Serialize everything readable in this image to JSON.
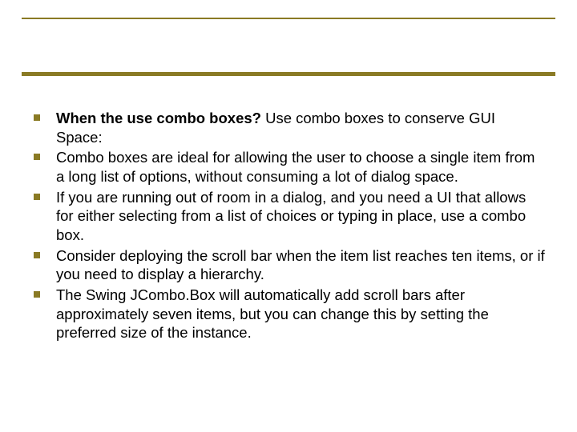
{
  "bullets": [
    {
      "bold_lead": "When the use combo boxes? ",
      "rest": "Use combo boxes to conserve GUI Space:"
    },
    {
      "bold_lead": "",
      "rest": "Combo boxes are ideal for allowing the user to choose a single item from a long list of options, without consuming a lot of dialog space."
    },
    {
      "bold_lead": "",
      "rest": "If you are running out of room in a dialog, and you need a UI that allows for either selecting from a list of choices or typing in place, use a combo box."
    },
    {
      "bold_lead": "",
      "rest": "Consider deploying the scroll bar when the item list reaches ten items, or if you need to display a hierarchy."
    },
    {
      "bold_lead": "",
      "rest": "The Swing JCombo.Box will automatically add scroll bars after approximately seven items, but you can change this by setting the preferred size of the instance."
    }
  ]
}
